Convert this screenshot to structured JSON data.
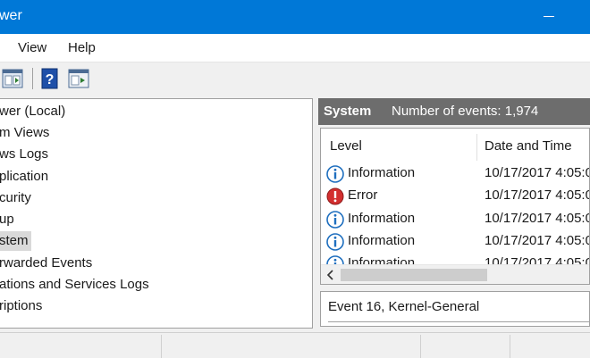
{
  "window": {
    "title": "wer"
  },
  "menu": {
    "items": [
      "View",
      "Help"
    ]
  },
  "tree": {
    "items": [
      {
        "label": "wer (Local)",
        "selected": false
      },
      {
        "label": "m Views",
        "selected": false
      },
      {
        "label": "ws Logs",
        "selected": false
      },
      {
        "label": "plication",
        "selected": false
      },
      {
        "label": "curity",
        "selected": false
      },
      {
        "label": "up",
        "selected": false
      },
      {
        "label": "stem",
        "selected": true
      },
      {
        "label": "rwarded Events",
        "selected": false
      },
      {
        "label": "ations and Services Logs",
        "selected": false
      },
      {
        "label": "riptions",
        "selected": false
      }
    ]
  },
  "log_header": {
    "name": "System",
    "count_text": "Number of events: 1,974"
  },
  "events": {
    "columns": [
      "Level",
      "Date and Time"
    ],
    "rows": [
      {
        "icon": "information-icon",
        "level": "Information",
        "date": "10/17/2017 4:05:0"
      },
      {
        "icon": "error-icon",
        "level": "Error",
        "date": "10/17/2017 4:05:0"
      },
      {
        "icon": "information-icon",
        "level": "Information",
        "date": "10/17/2017 4:05:0"
      },
      {
        "icon": "information-icon",
        "level": "Information",
        "date": "10/17/2017 4:05:0"
      },
      {
        "icon": "information-icon",
        "level": "Information",
        "date": "10/17/2017 4:05:0"
      }
    ]
  },
  "detail": {
    "caption": "Event 16, Kernel-General"
  },
  "colors": {
    "titlebar": "#0078d7",
    "info": "#1f6fbf",
    "error": "#d32f2f",
    "header": "#6d6d6d"
  }
}
